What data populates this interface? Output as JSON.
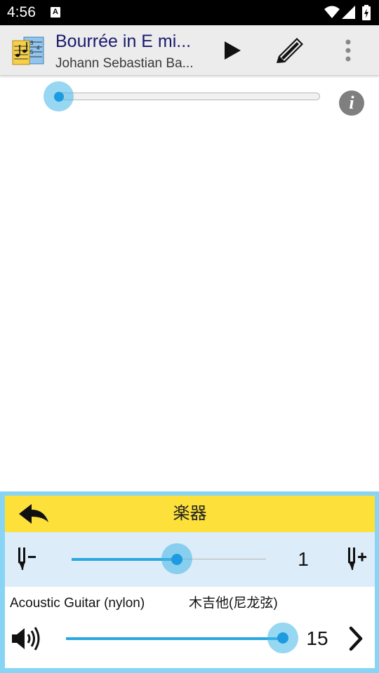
{
  "status_bar": {
    "time": "4:56",
    "notification_icon": "a-icon",
    "icons": [
      "wifi-icon",
      "signal-icon",
      "battery-icon"
    ]
  },
  "app_bar": {
    "title": "Bourrée in E mi...",
    "subtitle": "Johann Sebastian Ba...",
    "icons": [
      "sheet-music-app-icon",
      "play-icon",
      "pencil-icon",
      "more-vert-icon"
    ]
  },
  "playback": {
    "progress_fraction": 0.0,
    "info_label": "i"
  },
  "instrument_panel": {
    "title": "楽器",
    "capo": {
      "value": "1",
      "fraction": 0.56
    },
    "instrument_name_en": "Acoustic Guitar (nylon)",
    "instrument_name_zh": "木吉他(尼龙弦)",
    "volume": {
      "value": "15",
      "fraction": 1.0
    }
  },
  "colors": {
    "accent_blue": "#1e9be0",
    "header_yellow": "#fde03a",
    "panel_border": "#87d4f5",
    "capo_row_bg": "#dcecf8",
    "title_navy": "#1a1a6e"
  }
}
